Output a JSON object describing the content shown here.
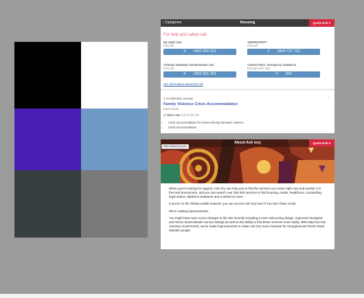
{
  "palette": {
    "colors": [
      "#000000",
      "#ffffff",
      "#4a1fb5",
      "#6f9ac5",
      "#383f41",
      "#7a7a7a"
    ]
  },
  "housing": {
    "back_label": "Categories",
    "title": "Housing",
    "exit_label": "Quick Exit X",
    "help_heading": "For help and safety call:",
    "contacts": [
      {
        "name": "My Aged Care",
        "sub": "Freecall",
        "number": "1800 200 422"
      },
      {
        "name": "1800RESPECT",
        "sub": "Freecall",
        "number": "1800 737 732"
      },
      {
        "name": "Victorian Statewide Homelessness Line",
        "sub": "Freecall",
        "number": "1800 825 955"
      },
      {
        "name": "Victoria Police, Emergency Assistance",
        "sub": "Emergencies only",
        "number": "000"
      }
    ],
    "see_info": "See information about this call",
    "confidential_label": "Confidential Location",
    "service_title": "Family Violence Crisis Accommodation",
    "service_sub": "Kara House",
    "open_now": "Open now",
    "open_until": "until 12:00 AM",
    "bullets": [
      "Crisis accommodation for women fleeing domestic violence",
      "Crisis accommodation"
    ]
  },
  "about": {
    "title": "About Ask Izzy",
    "exit_label": "Quick Exit X",
    "url_tooltip": "https://askizzy.org.au",
    "paragraphs": [
      "When you're looking for support, Ask Izzy can help you to find the services you need, right now and nearby. It is free and anonymous, and you can search over 350 000 services to find housing, meals, healthcare, counselling, legal advice, addiction treatment and a whole lot more.",
      "If you're on the Telstra mobile network, you can access Ask Izzy even if you don't have credit.",
      "We're making improvements.",
      "You might have seen some changes to the site recently including a more welcoming design, improved Aboriginal and Torres Strait Islander service listings as well as the ability to find these services more easily. With help from the Victorian Government, we've made improvements to make Ask Izzy more inclusive for Aboriginal and Torres Strait Islander people."
    ]
  },
  "icons": {
    "back": "chevron-left-icon",
    "phone": "phone-icon",
    "location": "location-pin-icon",
    "clock": "clock-icon",
    "chevron": "chevron-right-icon"
  }
}
